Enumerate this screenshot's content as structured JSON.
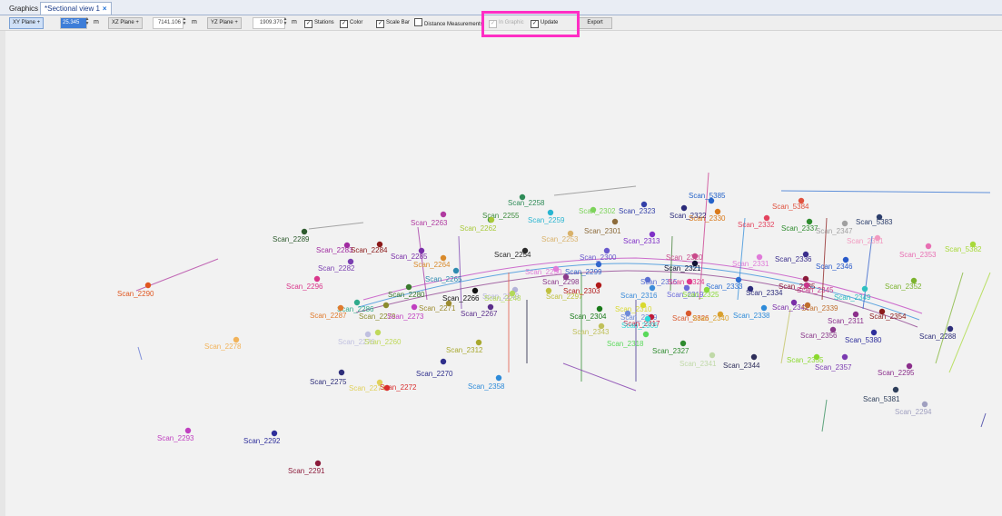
{
  "tabs": [
    {
      "label": "Graphics"
    },
    {
      "label": "*Sectional view 1",
      "close": "×"
    }
  ],
  "toolbar": {
    "xy_plane": {
      "label": "XY Plane +",
      "value": "25.345",
      "unit": "m"
    },
    "xz_plane": {
      "label": "XZ Plane +",
      "value": "7141.106",
      "unit": "m"
    },
    "yz_plane": {
      "label": "YZ Plane +",
      "value": "1909.370",
      "unit": "m"
    },
    "spin_up": "▲",
    "spin_down": "▼",
    "check_mark": "✓",
    "checkboxes": [
      {
        "label": "Stations",
        "checked": true
      },
      {
        "label": "Color",
        "checked": true
      },
      {
        "label": "Scale Bar",
        "checked": true
      },
      {
        "label": "Distance Measurements",
        "checked": false
      }
    ],
    "in_graphic": {
      "label": "In Graphic",
      "checked": true,
      "disabled": true
    },
    "update": {
      "label": "Update",
      "checked": true
    },
    "export_label": "Export"
  },
  "colors": {
    "highlight": "#ff2ec4",
    "background": "#f2f2f2",
    "selection": "#3d7dd8"
  },
  "scans": [
    {
      "label": "Scan_5385",
      "color": "#2563c9"
    },
    {
      "label": "Scan_2258",
      "color": "#2e8b57"
    },
    {
      "label": "Scan_2263",
      "color": "#b03aa0"
    },
    {
      "label": "Scan_2255",
      "color": "#3d8c3d"
    },
    {
      "label": "Scan_2259",
      "color": "#29b5d1"
    },
    {
      "label": "Scan_2302",
      "color": "#7cd35a"
    },
    {
      "label": "Scan_2323",
      "color": "#3340a8"
    },
    {
      "label": "Scan_2322",
      "color": "#2b2b7a"
    },
    {
      "label": "Scan_2330",
      "color": "#d9791a"
    },
    {
      "label": "Scan_5384",
      "color": "#e0523e"
    },
    {
      "label": "Scan_2332",
      "color": "#e3435e"
    },
    {
      "label": "Scan_2337",
      "color": "#2e8b2e"
    },
    {
      "label": "Scan_2347",
      "color": "#a0a0a0"
    },
    {
      "label": "Scan_5383",
      "color": "#2c3e6b"
    },
    {
      "label": "Scan_2289",
      "color": "#2d5a2d"
    },
    {
      "label": "Scan_2262",
      "color": "#a8c93a"
    },
    {
      "label": "Scan_2301",
      "color": "#8c6b3a"
    },
    {
      "label": "Scan_2253",
      "color": "#d9b26b"
    },
    {
      "label": "Scan_2313",
      "color": "#7f2fc7"
    },
    {
      "label": "Scan_2351",
      "color": "#f29ac0"
    },
    {
      "label": "Scan_2353",
      "color": "#e86fb3"
    },
    {
      "label": "Scan_5382",
      "color": "#a8d93a"
    },
    {
      "label": "Scan_2283",
      "color": "#a02ba0"
    },
    {
      "label": "Scan_2284",
      "color": "#8b1a1a"
    },
    {
      "label": "Scan_2285",
      "color": "#7a2fa8"
    },
    {
      "label": "Scan_2264",
      "color": "#d98a2b"
    },
    {
      "label": "Scan_2254",
      "color": "#2b2b2b"
    },
    {
      "label": "Scan_2300",
      "color": "#6a5acd"
    },
    {
      "label": "Scan_2320",
      "color": "#c94b8b"
    },
    {
      "label": "Scan_2331",
      "color": "#e07bd9"
    },
    {
      "label": "Scan_2336",
      "color": "#3b2e8c"
    },
    {
      "label": "Scan_2346",
      "color": "#2859c9"
    },
    {
      "label": "Scan_2282",
      "color": "#7a3fb0"
    },
    {
      "label": "Scan_2265",
      "color": "#2e8bb0"
    },
    {
      "label": "Scan_2250",
      "color": "#e07bd9"
    },
    {
      "label": "Scan_2299",
      "color": "#3366cc"
    },
    {
      "label": "Scan_2321",
      "color": "#111133"
    },
    {
      "label": "Scan_2296",
      "color": "#d9368b"
    },
    {
      "label": "Scan_2290",
      "color": "#e0561f"
    },
    {
      "label": "Scan_2280",
      "color": "#3b7a2e"
    },
    {
      "label": "Scan_2249",
      "color": "#b3b3d9"
    },
    {
      "label": "Scan_2297",
      "color": "#c0c040"
    },
    {
      "label": "Scan_2298",
      "color": "#8b3a8b"
    },
    {
      "label": "Scan_2303",
      "color": "#b01a1a"
    },
    {
      "label": "Scan_2315",
      "color": "#5a6fd1"
    },
    {
      "label": "Scan_2324",
      "color": "#e03a8c"
    },
    {
      "label": "Scan_2333",
      "color": "#2e6fd1"
    },
    {
      "label": "Scan_2334",
      "color": "#2b2b7a"
    },
    {
      "label": "Scan_2335",
      "color": "#8b1a3a"
    },
    {
      "label": "Scan_2345",
      "color": "#c9368b"
    },
    {
      "label": "Scan_2349",
      "color": "#2ec0c0"
    },
    {
      "label": "Scan_2352",
      "color": "#7cb32e"
    },
    {
      "label": "Scan_2266",
      "color": "#111111"
    },
    {
      "label": "Scan_2248",
      "color": "#b3d95a"
    },
    {
      "label": "Scan_2316",
      "color": "#3b8bd9"
    },
    {
      "label": "Scan_2319",
      "color": "#6a6ad9"
    },
    {
      "label": "Scan_2325",
      "color": "#8bd93a"
    },
    {
      "label": "Scan_2286",
      "color": "#2eaa8b"
    },
    {
      "label": "Scan_2287",
      "color": "#e07b2e"
    },
    {
      "label": "Scan_2279",
      "color": "#8b8b2e"
    },
    {
      "label": "Scan_2273",
      "color": "#c040c0"
    },
    {
      "label": "Scan_2271",
      "color": "#9b8b2e"
    },
    {
      "label": "Scan_2267",
      "color": "#5a2e8b"
    },
    {
      "label": "Scan_2304",
      "color": "#1a7a1a"
    },
    {
      "label": "Scan_2310",
      "color": "#d9d92e"
    },
    {
      "label": "Scan_2309",
      "color": "#6f8bd9"
    },
    {
      "label": "Scan_2317",
      "color": "#c01a3a"
    },
    {
      "label": "Scan_2326",
      "color": "#d95a2e"
    },
    {
      "label": "Scan_2340",
      "color": "#d9a02e"
    },
    {
      "label": "Scan_2338",
      "color": "#2e8bd9"
    },
    {
      "label": "Scan_2342",
      "color": "#7a2ea8"
    },
    {
      "label": "Scan_2339",
      "color": "#c06f2e"
    },
    {
      "label": "Scan_2354",
      "color": "#8b1a1a"
    },
    {
      "label": "Scan_2311",
      "color": "#8b2e8b"
    },
    {
      "label": "Scan_2305",
      "color": "#2ed9d9"
    },
    {
      "label": "Scan_2343",
      "color": "#c0c05a"
    },
    {
      "label": "Scan_2356",
      "color": "#8b3a8b"
    },
    {
      "label": "Scan_5380",
      "color": "#2e2e9b"
    },
    {
      "label": "Scan_2288",
      "color": "#2e2e7a"
    },
    {
      "label": "Scan_2278",
      "color": "#f2b35a"
    },
    {
      "label": "Scan_2276",
      "color": "#c0c0e0"
    },
    {
      "label": "Scan_2260",
      "color": "#c0d95a"
    },
    {
      "label": "Scan_2312",
      "color": "#a8a82e"
    },
    {
      "label": "Scan_2318",
      "color": "#5ad95a"
    },
    {
      "label": "Scan_2327",
      "color": "#2e8b2e"
    },
    {
      "label": "Scan_2341",
      "color": "#c0d9a8"
    },
    {
      "label": "Scan_2344",
      "color": "#2e2e5a"
    },
    {
      "label": "Scan_2355",
      "color": "#8bd92e"
    },
    {
      "label": "Scan_2357",
      "color": "#7a3ab0"
    },
    {
      "label": "Scan_2295",
      "color": "#8b2e8b"
    },
    {
      "label": "Scan_2275",
      "color": "#2e2e7a"
    },
    {
      "label": "Scan_2274",
      "color": "#e0d05a"
    },
    {
      "label": "Scan_2272",
      "color": "#d92e2e"
    },
    {
      "label": "Scan_2270",
      "color": "#2e2e8b"
    },
    {
      "label": "Scan_2358",
      "color": "#2e8bd9"
    },
    {
      "label": "Scan_5381",
      "color": "#2e3e5a"
    },
    {
      "label": "Scan_2294",
      "color": "#a0a0c0"
    },
    {
      "label": "Scan_2293",
      "color": "#c040c0"
    },
    {
      "label": "Scan_2292",
      "color": "#2e2e9b"
    },
    {
      "label": "Scan_2291",
      "color": "#8b1a3a"
    }
  ]
}
